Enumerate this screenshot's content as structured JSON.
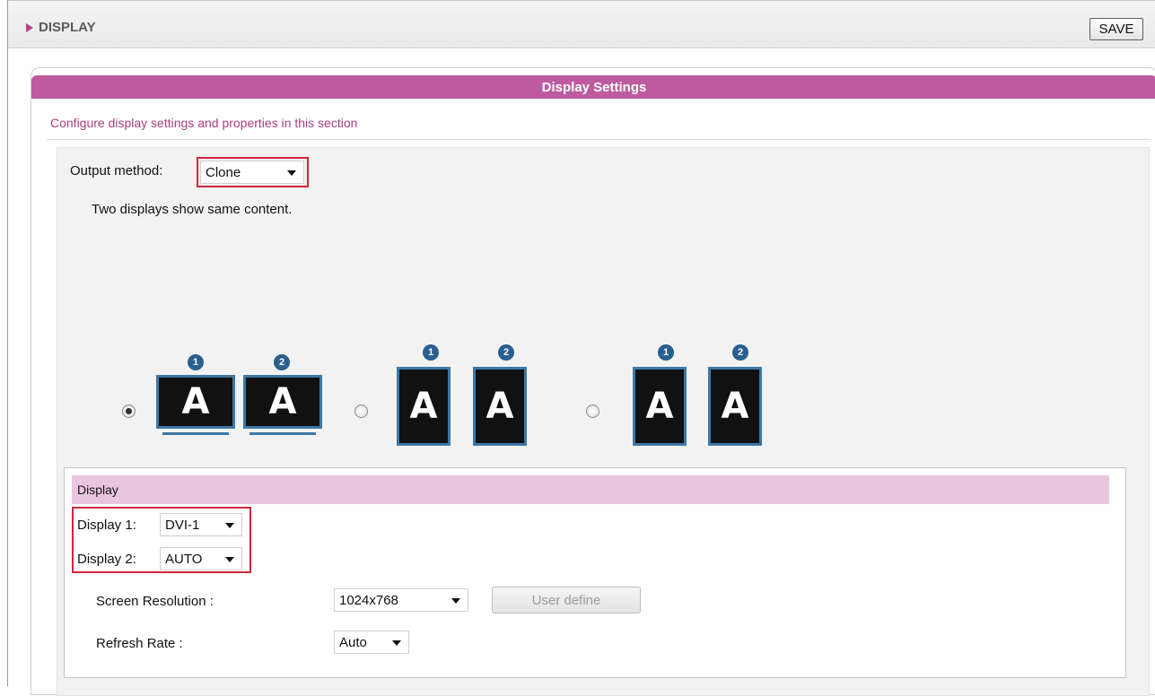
{
  "header": {
    "title": "DISPLAY",
    "save_label": "SAVE"
  },
  "panel": {
    "title": "Display Settings",
    "description": "Configure display settings and properties in this section"
  },
  "output": {
    "label": "Output method:",
    "value": "Clone",
    "hint": "Two displays show same content."
  },
  "layouts": [
    {
      "selected": true,
      "orientation": "landscape",
      "screen_text": "A",
      "numbers": [
        "1",
        "2"
      ]
    },
    {
      "selected": false,
      "orientation": "portrait",
      "screen_text": "A",
      "numbers": [
        "1",
        "2"
      ]
    },
    {
      "selected": false,
      "orientation": "portrait",
      "screen_text": "A",
      "numbers": [
        "1",
        "2"
      ]
    }
  ],
  "display_section": {
    "title": "Display",
    "display1_label": "Display 1:",
    "display1_value": "DVI-1",
    "display2_label": "Display 2:",
    "display2_value": "AUTO",
    "resolution_label": "Screen Resolution :",
    "resolution_value": "1024x768",
    "user_define_label": "User define",
    "refresh_label": "Refresh Rate :",
    "refresh_value": "Auto"
  },
  "colors": {
    "accent": "#bd5aa0",
    "accent_light": "#e9c6de",
    "highlight_outline": "#d0263a",
    "monitor_frame": "#3c78a8"
  }
}
